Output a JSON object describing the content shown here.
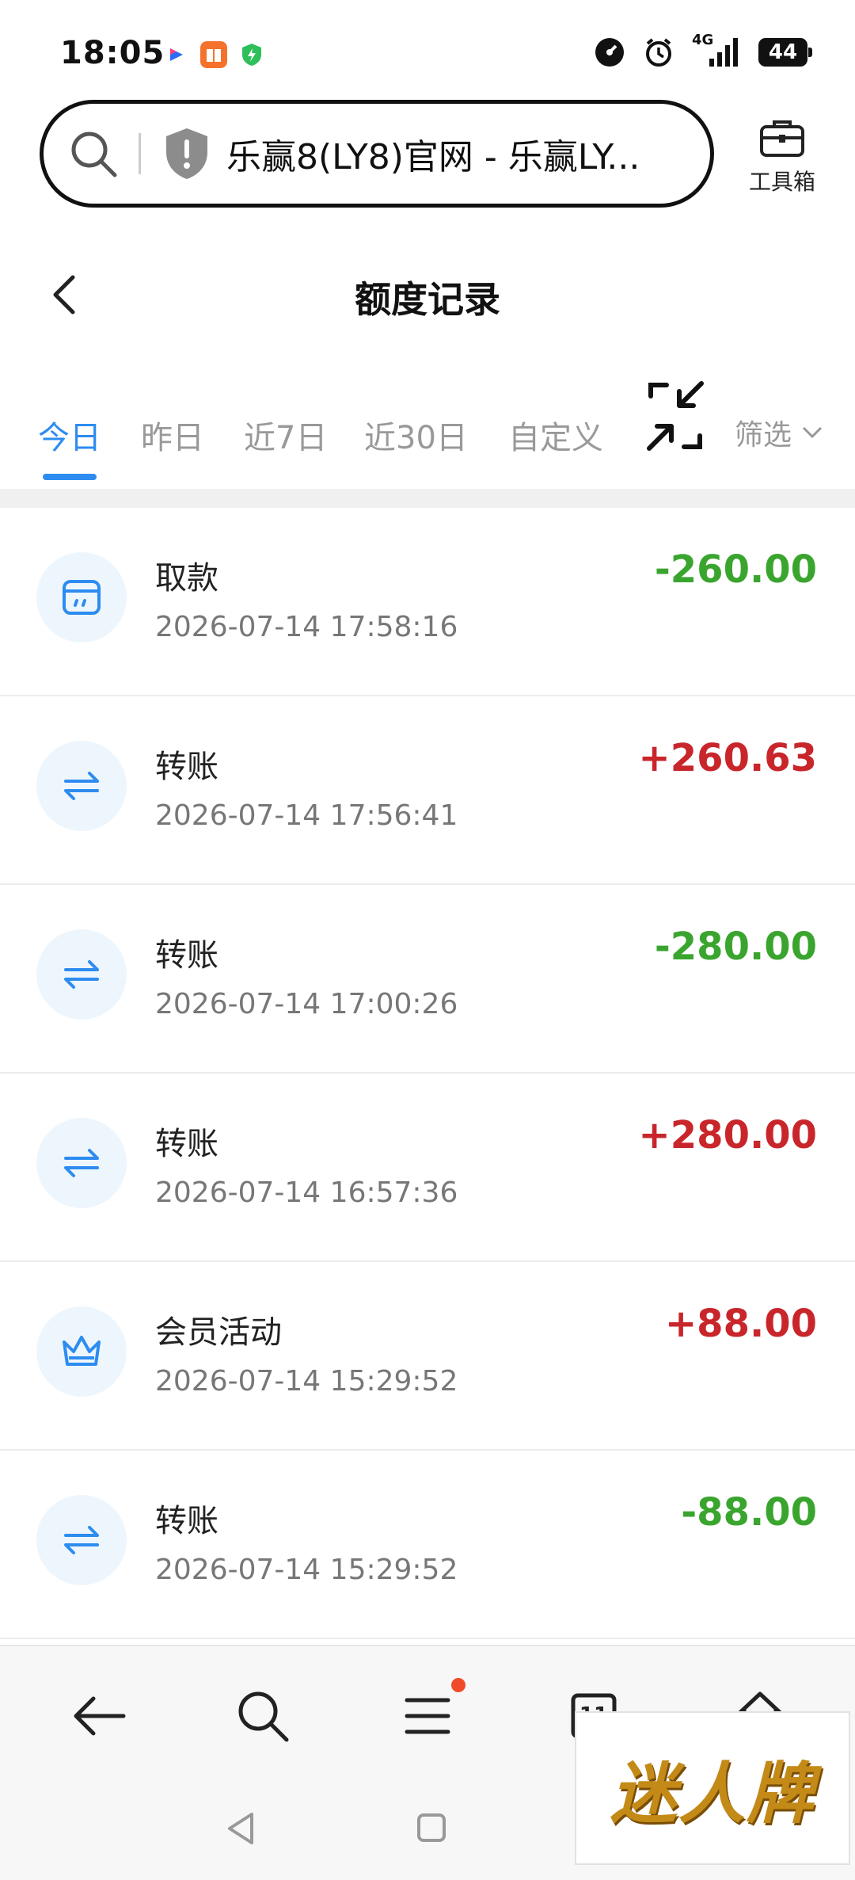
{
  "status_bar": {
    "time": "18:05",
    "network": "4G",
    "battery": "44"
  },
  "browser": {
    "address_text": "乐赢8(LY8)官网 - 乐赢LY...",
    "toolbox_label": "工具箱"
  },
  "page": {
    "title": "额度记录"
  },
  "tabs": [
    {
      "label": "今日",
      "active": true
    },
    {
      "label": "昨日",
      "active": false
    },
    {
      "label": "近7日",
      "active": false
    },
    {
      "label": "近30日",
      "active": false
    },
    {
      "label": "自定义",
      "active": false
    }
  ],
  "filter_label": "筛选",
  "records": [
    {
      "type": "取款",
      "time": "2026-07-14 17:58:16",
      "amount": "-260.00",
      "icon": "withdraw-icon"
    },
    {
      "type": "转账",
      "time": "2026-07-14 17:56:41",
      "amount": "+260.63",
      "icon": "transfer-icon"
    },
    {
      "type": "转账",
      "time": "2026-07-14 17:00:26",
      "amount": "-280.00",
      "icon": "transfer-icon"
    },
    {
      "type": "转账",
      "time": "2026-07-14 16:57:36",
      "amount": "+280.00",
      "icon": "transfer-icon"
    },
    {
      "type": "会员活动",
      "time": "2026-07-14 15:29:52",
      "amount": "+88.00",
      "icon": "crown-icon"
    },
    {
      "type": "转账",
      "time": "2026-07-14 15:29:52",
      "amount": "-88.00",
      "icon": "transfer-icon"
    }
  ],
  "bottom_nav": {
    "tab_count": "11"
  },
  "watermark_text": "迷人牌",
  "colors": {
    "accent": "#2d8cf0",
    "positive": "#c8262b",
    "negative": "#3aa52e"
  }
}
